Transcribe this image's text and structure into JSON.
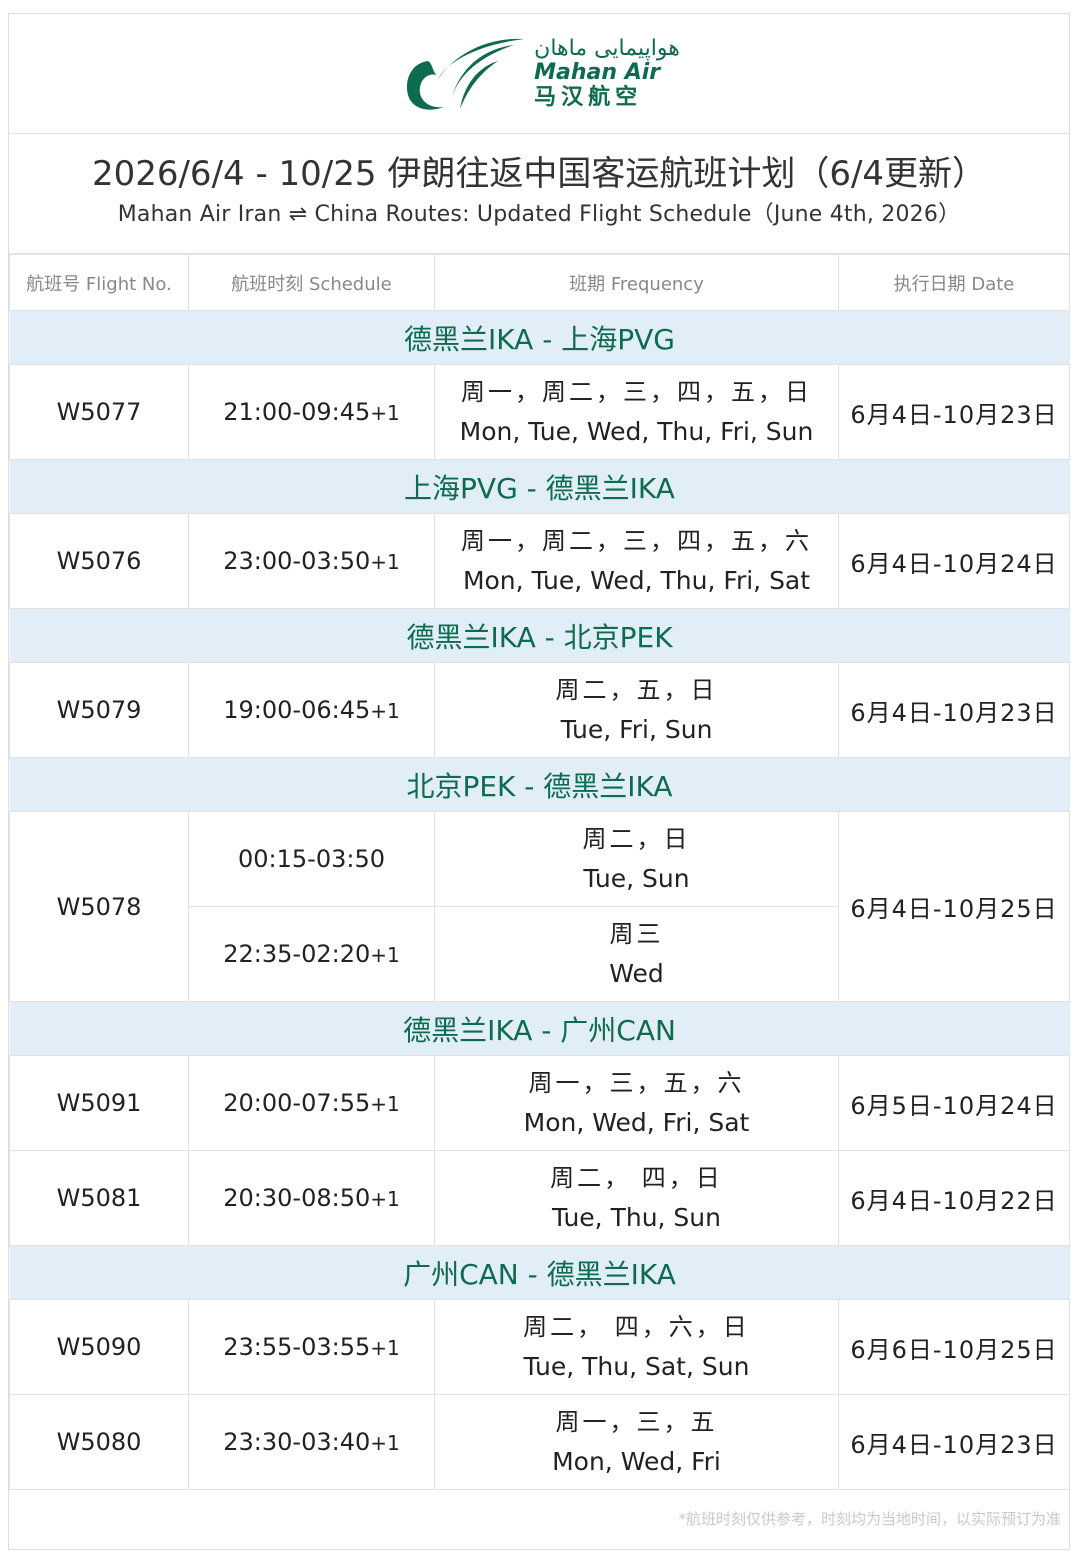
{
  "logo": {
    "persian": "هواپیمایی ماهان",
    "english": "Mahan Air",
    "chinese": "马汉航空",
    "color": "#0f6b4f"
  },
  "title": {
    "cn": "2026/6/4 - 10/25  伊朗往返中国客运航班计划（6/4更新）",
    "en": "Mahan Air Iran ⇌ China Routes: Updated Flight Schedule（June 4th, 2026）"
  },
  "headers": {
    "flight_no": "航班号 Flight No.",
    "schedule": "航班时刻  Schedule",
    "frequency": "班期  Frequency",
    "date": "执行日期  Date"
  },
  "routes": [
    {
      "name": "德黑兰IKA - 上海PVG",
      "flights": [
        {
          "no": "W5077",
          "time": "21:00-09:45",
          "plus": "+1",
          "freq_cn": "周一，周二，三，四，五，日",
          "freq_en": "Mon, Tue, Wed, Thu, Fri, Sun",
          "date": "6月4日-10月23日"
        }
      ]
    },
    {
      "name": "上海PVG - 德黑兰IKA",
      "flights": [
        {
          "no": "W5076",
          "time": "23:00-03:50",
          "plus": "+1",
          "freq_cn": "周一，周二，三，四，五，六",
          "freq_en": "Mon, Tue, Wed, Thu, Fri, Sat",
          "date": "6月4日-10月24日"
        }
      ]
    },
    {
      "name": "德黑兰IKA - 北京PEK",
      "flights": [
        {
          "no": "W5079",
          "time": "19:00-06:45",
          "plus": "+1",
          "freq_cn": "周二，五，日",
          "freq_en": "Tue, Fri, Sun",
          "date": "6月4日-10月23日"
        }
      ]
    },
    {
      "name": "北京PEK - 德黑兰IKA",
      "flights": [
        {
          "no": "W5078",
          "date": "6月4日-10月25日",
          "slots": [
            {
              "time": "00:15-03:50",
              "plus": "",
              "freq_cn": "周二，日",
              "freq_en": "Tue, Sun"
            },
            {
              "time": "22:35-02:20",
              "plus": "+1",
              "freq_cn": "周三",
              "freq_en": "Wed"
            }
          ]
        }
      ]
    },
    {
      "name": "德黑兰IKA - 广州CAN",
      "flights": [
        {
          "no": "W5091",
          "time": "20:00-07:55",
          "plus": "+1",
          "freq_cn": "周一，三，五，六",
          "freq_en": "Mon, Wed, Fri, Sat",
          "date": "6月5日-10月24日"
        },
        {
          "no": "W5081",
          "time": "20:30-08:50",
          "plus": "+1",
          "freq_cn": "周二， 四，日",
          "freq_en": "Tue, Thu, Sun",
          "date": "6月4日-10月22日"
        }
      ]
    },
    {
      "name": "广州CAN - 德黑兰IKA",
      "flights": [
        {
          "no": "W5090",
          "time": "23:55-03:55",
          "plus": "+1",
          "freq_cn": "周二， 四，六，日",
          "freq_en": "Tue, Thu, Sat, Sun",
          "date": "6月6日-10月25日"
        },
        {
          "no": "W5080",
          "time": "23:30-03:40",
          "plus": "+1",
          "freq_cn": "周一，三，五",
          "freq_en": "Mon, Wed, Fri",
          "date": "6月4日-10月23日"
        }
      ]
    }
  ],
  "footer": "*航班时刻仅供参考，时刻均为当地时间，以实际预订为准",
  "colors": {
    "route_band": "#e1eef8",
    "route_text": "#0f6b4f",
    "border": "#e2e2e2"
  }
}
